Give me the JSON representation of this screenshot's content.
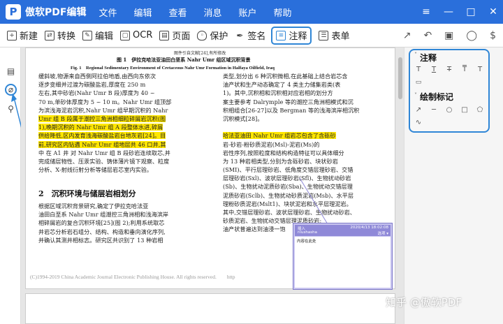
{
  "app": {
    "logo_letter": "P",
    "title": "傲软PDF编辑"
  },
  "menu": [
    "文件",
    "编辑",
    "查看",
    "消息",
    "账户",
    "帮助"
  ],
  "window_controls": [
    "≡",
    "—",
    "□",
    "✕"
  ],
  "toolbar": {
    "items": [
      {
        "label": "新建",
        "icon": "new-file-icon"
      },
      {
        "label": "转换",
        "icon": "convert-icon"
      },
      {
        "label": "编辑",
        "icon": "edit-icon"
      },
      {
        "label": "OCR",
        "icon": "ocr-icon"
      },
      {
        "label": "页面",
        "icon": "page-icon"
      },
      {
        "label": "保护",
        "icon": "shield-icon"
      },
      {
        "label": "签名",
        "icon": "pen-icon"
      },
      {
        "label": "注释",
        "icon": "comment-icon",
        "highlighted": true
      },
      {
        "label": "表单",
        "icon": "form-icon"
      }
    ],
    "right_icons": [
      "share-icon",
      "undo-icon",
      "save-icon",
      "user-icon",
      "credit-icon"
    ]
  },
  "left_sidebar": {
    "icons": [
      "thumbnail-icon",
      "bookmark-icon",
      "search-icon"
    ],
    "bookmark_callout": "书签"
  },
  "document": {
    "figure_note": "图件引自文献[24],有所修改",
    "figure_title_cn": "图 1　伊拉克哈法亚油田白垩系 Nahr Umr 组区域沉积背景",
    "figure_title_en": "Fig. 1　Regional Sedimentary Environment of Cretaceous Nahr Umr Formation in Halfaya Oilfield, Iraq",
    "left_col": [
      {
        "t": "缓斜坡,物源来自西侧阿拉伯地盾,由西向东依次"
      },
      {
        "t": "逐步变细并过渡为碳酸盐岩,厚度在 250 m"
      },
      {
        "t": "左右,其中砂岩(Nahr Umr B 段)厚度为 40 ~"
      },
      {
        "t": "70 m,单砂体厚度为 5 ~ 10 m。Nahr Umr 组顶部"
      },
      {
        "t": "为滨浅海泥岩沉积,Nahr Umr 组早期沉积的 Nahr"
      },
      {
        "t": "Umr 组 B 段属于潮控三角洲相细粒碎屑岩沉积(图",
        "h": true
      },
      {
        "t": "1),晚期沉积的 Nahr Umr 组 A 段整体水进,碎屑",
        "h": true
      },
      {
        "t": "供给降低,区内发育浅海碳酸盐岩台地灰岩[24]。目",
        "h": true
      },
      {
        "t": "前,研究区内钻遇 Nahr Umr 组地层共 46 口井,其",
        "h": true
      },
      {
        "t": "中 在 A1 井 对 Nahr Umr 组 B 段砂岩连续取芯,并"
      },
      {
        "t": "完成储层物性、压汞实验、铸体薄片镜下观察、粒度"
      },
      {
        "t": "分析、X-射线衍射分析等储层岩芯室内实验。"
      }
    ],
    "section_title": "2　沉积环境与储层岩相划分",
    "left_col2": [
      {
        "t": "根据区域沉积背景研究,确定了伊拉克哈法亚"
      },
      {
        "t": "油田白垩系 Nahr Umr 组潮控三角洲相和浅海滨岸"
      },
      {
        "t": "相碎屑岩的复合沉积环境[25](图 2);利用系统取芯"
      },
      {
        "t": "井岩芯分析岩石组分、结构、构造和垂向演化序列,"
      },
      {
        "t": "并确认其测井相标志。研究区共识别了 13 种岩相"
      }
    ],
    "right_col": [
      {
        "t": "类型,划分出 6 种沉积微相,在此基础上结合岩芯含"
      },
      {
        "t": "油产状和生产动态确定了 4 类主力储集岩类(表"
      },
      {
        "t": "1)。其中,沉积相和沉积相对应岩相的划分方"
      },
      {
        "t": "案主要参考 Dalrymple 等的潮控三角洲相模式和沉"
      },
      {
        "t": "积相组合[26-27]以及 Bergman 等的浅海滨岸相沉积"
      },
      {
        "t": "沉积模式[28]。"
      },
      {
        "t": ""
      },
      {
        "t": "哈法亚油田 Nahr Umr 组岩芯包含了含砾砂",
        "h": true
      },
      {
        "t": "岩-砂岩-粉砂质泥岩(Msl)-泥岩(Ms)的"
      },
      {
        "t": "岩性序列,按照粒度和结构构造特征可以具体细分"
      },
      {
        "t": "为 13 种岩相类型,分别为含砾砂岩、块状砂岩"
      },
      {
        "t": "(SMI)、平行层理砂岩、低角度交错层理砂岩、交错"
      },
      {
        "t": "层理砂岩(Sxl)、波状层理砂岩(Sfl)、生物扰动砂岩"
      },
      {
        "t": "(Sb)、生物扰动泥质砂岩(Sba)、生物扰动交错层理"
      },
      {
        "t": "泥质砂岩(Sclb)、生物扰动砂质泥岩(Msb)、水平层"
      },
      {
        "t": "理粉砂质泥岩(Mslt1)、块状泥岩和水平层理泥岩。"
      },
      {
        "t": "其中,交错层理砂岩、波状层理砂岩、生物扰动砂岩、"
      },
      {
        "t": "砂质泥岩、生物扰动交错层理泥质砂岩;"
      },
      {
        "t": "油产状普遍达到油浸一饱"
      }
    ],
    "copyright": "(C)1994-2019 China Academic Journal Electronic Publishing House. All rights reserved.　　http"
  },
  "comment_popup": {
    "author_label": "插入",
    "timestamp": "2020/4/13 18:02:08",
    "user": "niushasha",
    "options": "选项 ▾",
    "body": "内容在此处"
  },
  "right_panel": {
    "annotate_heading": "注释",
    "annotate_tools": [
      "T",
      "T",
      "T",
      "T",
      "T"
    ],
    "note_icon": "note-icon",
    "draw_heading": "绘制标记",
    "draw_tools": [
      "↗",
      "─",
      "○",
      "□",
      "⬠"
    ],
    "freehand": "∿"
  },
  "watermark": "知乎 @傲软PDF"
}
